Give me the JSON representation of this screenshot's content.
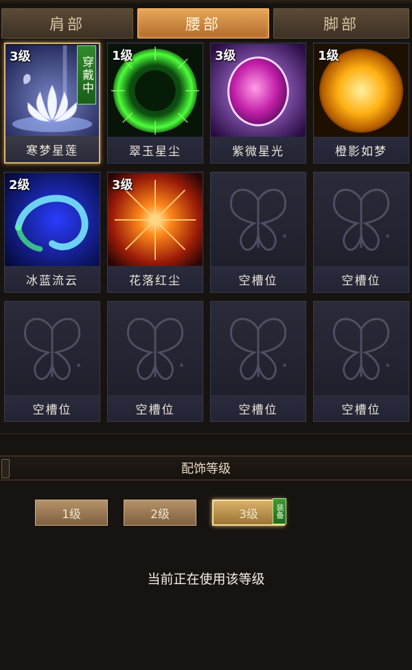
{
  "tabs": [
    {
      "label": "肩部",
      "active": false
    },
    {
      "label": "腰部",
      "active": true
    },
    {
      "label": "脚部",
      "active": false
    }
  ],
  "slots": [
    {
      "name": "寒梦星莲",
      "level": "3级",
      "wear": "穿戴中",
      "art": "lotus-icon"
    },
    {
      "name": "翠玉星尘",
      "level": "1级",
      "art": "green-orb-icon"
    },
    {
      "name": "紫微星光",
      "level": "3级",
      "art": "purple-orb-icon"
    },
    {
      "name": "橙影如梦",
      "level": "1级",
      "art": "sun-orb-icon"
    },
    {
      "name": "冰蓝流云",
      "level": "2级",
      "art": "blue-swirl-icon"
    },
    {
      "name": "花落红尘",
      "level": "3级",
      "art": "red-burst-icon"
    },
    {
      "name": "空槽位",
      "art": "butterfly-icon"
    },
    {
      "name": "空槽位",
      "art": "butterfly-icon"
    },
    {
      "name": "空槽位",
      "art": "butterfly-icon"
    },
    {
      "name": "空槽位",
      "art": "butterfly-icon"
    },
    {
      "name": "空槽位",
      "art": "butterfly-icon"
    },
    {
      "name": "空槽位",
      "art": "butterfly-icon"
    }
  ],
  "level_panel": {
    "title": "配饰等级",
    "buttons": [
      "1级",
      "2级",
      "3级"
    ],
    "active_index": 2,
    "equip_tag": "装备",
    "status": "当前正在使用该等级"
  },
  "colors": {
    "accent": "#d9b572",
    "tab_active": "#e7a85a",
    "wear_green": "#2f8a2c"
  }
}
